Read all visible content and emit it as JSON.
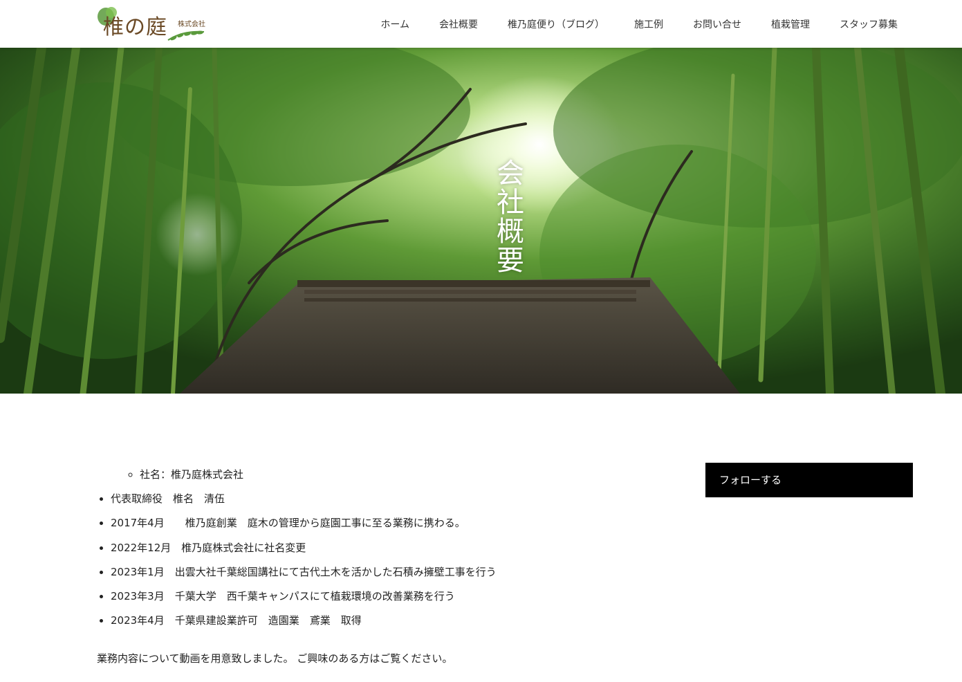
{
  "header": {
    "logo_text": "椎の庭",
    "logo_sub": "株式会社",
    "nav": [
      "ホーム",
      "会社概要",
      "椎乃庭便り（ブログ）",
      "施工例",
      "お問い合せ",
      "植栽管理",
      "スタッフ募集"
    ]
  },
  "hero": {
    "title": "会社概要"
  },
  "content": {
    "sub_items": [
      "社名：椎乃庭株式会社"
    ],
    "items": [
      "代表取締役　椎名　清伍",
      "2017年4月　　椎乃庭創業　庭木の管理から庭園工事に至る業務に携わる。",
      "2022年12月　椎乃庭株式会社に社名変更",
      "2023年1月　出雲大社千葉総国講社にて古代土木を活かした石積み擁壁工事を行う",
      "2023年3月　千葉大学　西千葉キャンパスにて植栽環境の改善業務を行う",
      "2023年4月　千葉県建設業許可　造園業　鳶業　取得"
    ],
    "note": "業務内容について動画を用意致しました。 ご興味のある方はご覧ください。"
  },
  "sidebar": {
    "follow_label": "フォローする"
  },
  "colors": {
    "logo_brown": "#6b4a26",
    "logo_green": "#5a9a3c",
    "follow_bg": "#000000"
  }
}
